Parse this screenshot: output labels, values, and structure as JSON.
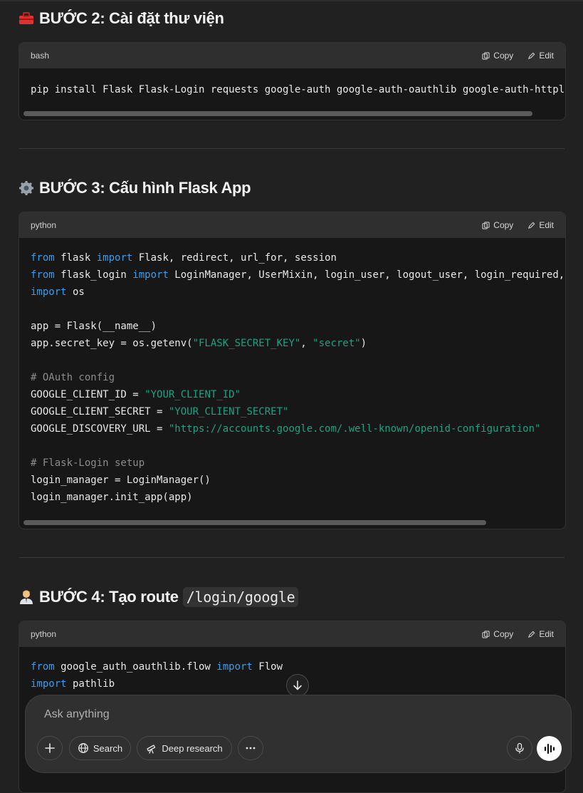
{
  "sections": [
    {
      "title": "BƯỚC 2: Cài đặt thư viện",
      "emoji": "🧰",
      "block": {
        "lang": "bash",
        "copy_label": "Copy",
        "edit_label": "Edit",
        "lines": [
          "pip install Flask Flask-Login requests google-auth google-auth-oauthlib google-auth-httpl"
        ]
      }
    },
    {
      "title": "BƯỚC 3: Cấu hình Flask App",
      "emoji": "⚙️",
      "block": {
        "lang": "python",
        "copy_label": "Copy",
        "edit_label": "Edit",
        "lines": [
          "from flask import Flask, redirect, url_for, session",
          "from flask_login import LoginManager, UserMixin, login_user, logout_user, login_required,",
          "import os",
          "",
          "app = Flask(__name__)",
          "app.secret_key = os.getenv(\"FLASK_SECRET_KEY\", \"secret\")",
          "",
          "# OAuth config",
          "GOOGLE_CLIENT_ID = \"YOUR_CLIENT_ID\"",
          "GOOGLE_CLIENT_SECRET = \"YOUR_CLIENT_SECRET\"",
          "GOOGLE_DISCOVERY_URL = \"https://accounts.google.com/.well-known/openid-configuration\"",
          "",
          "# Flask-Login setup",
          "login_manager = LoginManager()",
          "login_manager.init_app(app)"
        ]
      }
    },
    {
      "title": "BƯỚC 4: Tạo route",
      "title_code": "/login/google",
      "emoji": "🧑‍💼",
      "block": {
        "lang": "python",
        "copy_label": "Copy",
        "edit_label": "Edit",
        "lines": [
          "from google_auth_oauthlib.flow import Flow",
          "import pathlib"
        ]
      }
    }
  ],
  "composer": {
    "placeholder": "Ask anything",
    "search_label": "Search",
    "deep_research_label": "Deep research",
    "icons": [
      "plus-icon",
      "globe-icon",
      "telescope-icon",
      "more-icon",
      "microphone-icon",
      "voice-wave-icon"
    ]
  }
}
